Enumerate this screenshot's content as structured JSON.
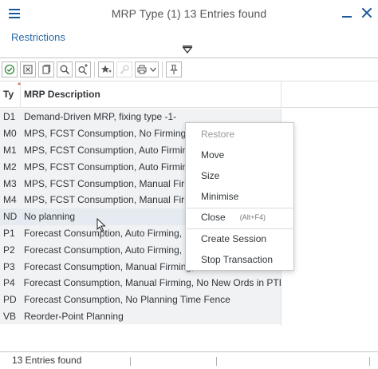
{
  "window": {
    "title": "MRP Type (1)   13 Entries found"
  },
  "restrictions_label": "Restrictions",
  "icons": {
    "menu": "hamburger-menu-icon",
    "minimize": "minimize-icon",
    "close": "close-icon",
    "collapse": "collapse-arrow-icon",
    "toolbar": [
      "checkmark-icon",
      "cancel-icon",
      "copy-icon",
      "find-icon",
      "find-next-icon",
      "favorites-icon",
      "key-icon",
      "print-icon",
      "dropdown-icon",
      "pin-icon"
    ]
  },
  "table": {
    "columns": [
      "Ty",
      "MRP Description"
    ],
    "rows": [
      {
        "ty": "D1",
        "desc": "Demand-Driven MRP, fixing type -1-"
      },
      {
        "ty": "M0",
        "desc": "MPS, FCST Consumption, No Firming"
      },
      {
        "ty": "M1",
        "desc": "MPS, FCST Consumption, Auto Firming, Fir"
      },
      {
        "ty": "M2",
        "desc": "MPS, FCST Consumption, Auto Firming, Fir"
      },
      {
        "ty": "M3",
        "desc": "MPS, FCST Consumption, Manual Firming"
      },
      {
        "ty": "M4",
        "desc": "MPS, FCST Consumption, Manual Firming"
      },
      {
        "ty": "ND",
        "desc": "No planning"
      },
      {
        "ty": "P1",
        "desc": "Forecast Consumption, Auto Firming, New"
      },
      {
        "ty": "P2",
        "desc": "Forecast Consumption, Auto Firming, No N"
      },
      {
        "ty": "P3",
        "desc": "Forecast Consumption, Manual Firming, No"
      },
      {
        "ty": "P4",
        "desc": "Forecast Consumption, Manual Firming, No New Ords in PTF"
      },
      {
        "ty": "PD",
        "desc": "Forecast Consumption, No Planning Time Fence"
      },
      {
        "ty": "VB",
        "desc": "Reorder-Point Planning"
      }
    ]
  },
  "context_menu": {
    "restore": "Restore",
    "move": "Move",
    "size": "Size",
    "minimise": "Minimise",
    "close": "Close",
    "close_shortcut": "(Alt+F4)",
    "create_session": "Create Session",
    "stop_transaction": "Stop Transaction"
  },
  "status": {
    "text": "13 Entries found"
  },
  "colors": {
    "accent": "#1a5a99",
    "link": "#2b6aa8",
    "row_bg": "#f0f2f4"
  }
}
